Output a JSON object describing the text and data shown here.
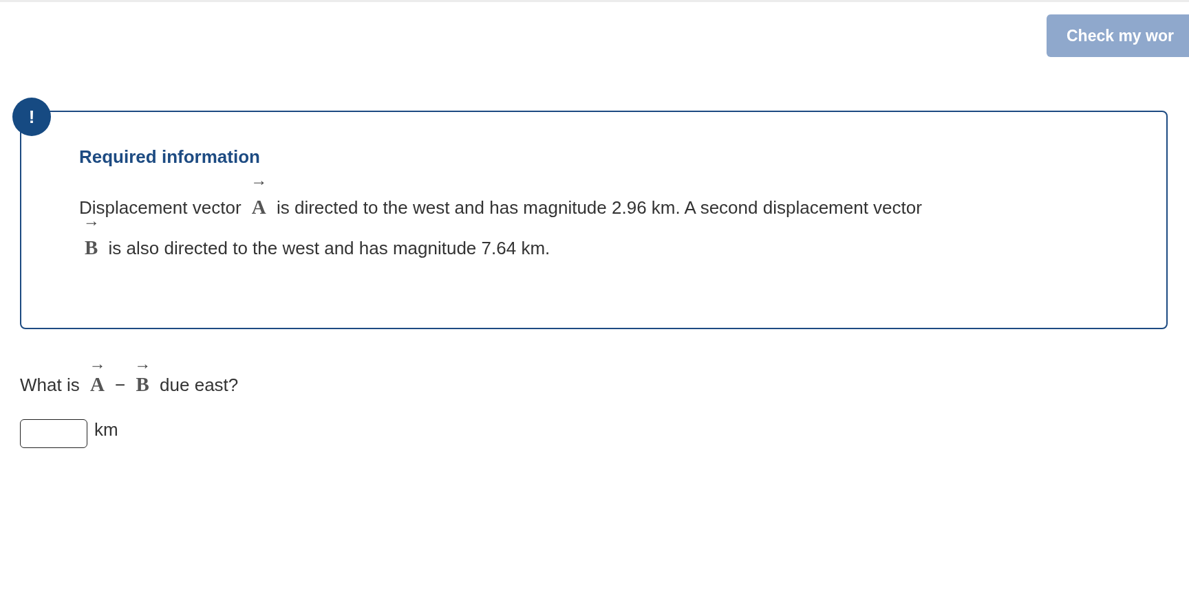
{
  "header": {
    "check_button": {
      "label": "Check my wor",
      "disabled": true
    }
  },
  "required_info": {
    "icon": "!",
    "title": "Required information",
    "paragraph": [
      {
        "kind": "text",
        "text": "Displacement vector "
      },
      {
        "kind": "vector",
        "symbol": "A",
        "arrow": "→"
      },
      {
        "kind": "text",
        "text": " is directed to the west and has magnitude 2.96 km. A second displacement vector "
      },
      {
        "kind": "vector",
        "symbol": "B",
        "arrow": "→"
      },
      {
        "kind": "text",
        "text": " is also directed to the west and has magnitude 7.64 km."
      }
    ]
  },
  "question": {
    "parts": [
      {
        "kind": "text",
        "text": "What is "
      },
      {
        "kind": "vector",
        "symbol": "A",
        "arrow": "→"
      },
      {
        "kind": "text",
        "text": " − "
      },
      {
        "kind": "vector",
        "symbol": "B",
        "arrow": "→"
      },
      {
        "kind": "text",
        "text": " due east?"
      }
    ],
    "answer": {
      "unit": "km"
    }
  }
}
